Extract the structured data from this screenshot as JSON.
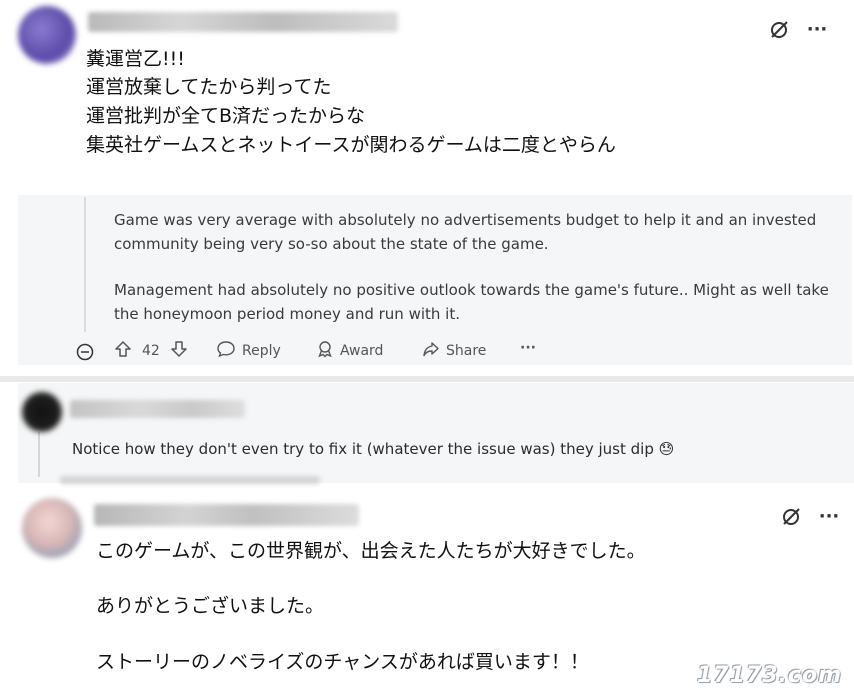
{
  "comment1": {
    "lines": [
      "糞運営乙!!!",
      "運営放棄してたから判ってた",
      "運営批判が全てB済だったからな",
      "集英社ゲームスとネットイースが関わるゲームは二度とやらん"
    ]
  },
  "quoted": {
    "paragraph1_line1": "Game was very average with absolutely no advertisements budget to help it and an invested",
    "paragraph1_line2": "community being very so-so about the state of the game.",
    "paragraph2_line1": "Management had absolutely no positive outlook towards the game's future.. Might as well take",
    "paragraph2_line2": "the honeymoon period money and run with it.",
    "vote_count": "42",
    "reply_label": "Reply",
    "award_label": "Award",
    "share_label": "Share",
    "more_label": "···"
  },
  "comment2": {
    "text": "Notice how they don't even try to fix it (whatever the issue was) they just dip 😓"
  },
  "comment3": {
    "lines": [
      "このゲームが、この世界観が、出会えた人たちが大好きでした。",
      "ありがとうございました。",
      "ストーリーのノベライズのチャンスがあれば買います！！"
    ]
  },
  "watermark": "17173.com",
  "more_icon": "···"
}
